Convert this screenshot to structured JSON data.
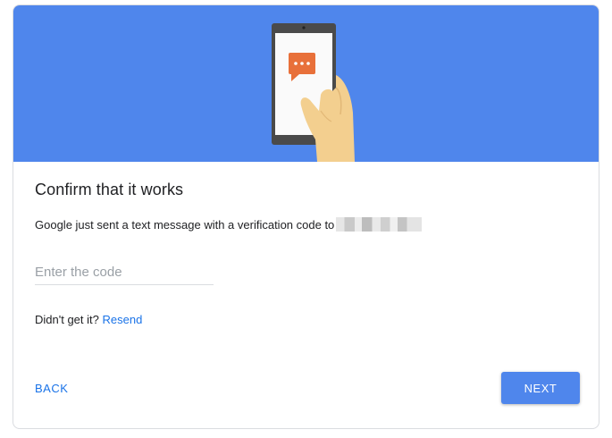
{
  "colors": {
    "banner": "#4f86ec",
    "accent": "#1a73e8",
    "next_button": "#4f86ec"
  },
  "illustration": {
    "icon": "phone-with-message-icon"
  },
  "dialog": {
    "title": "Confirm that it works",
    "description": "Google just sent a text message with a verification code to",
    "phone_number_redacted": true
  },
  "code_input": {
    "value": "",
    "placeholder": "Enter the code"
  },
  "resend": {
    "prompt": "Didn't get it?",
    "link_label": "Resend"
  },
  "actions": {
    "back_label": "BACK",
    "next_label": "NEXT"
  }
}
